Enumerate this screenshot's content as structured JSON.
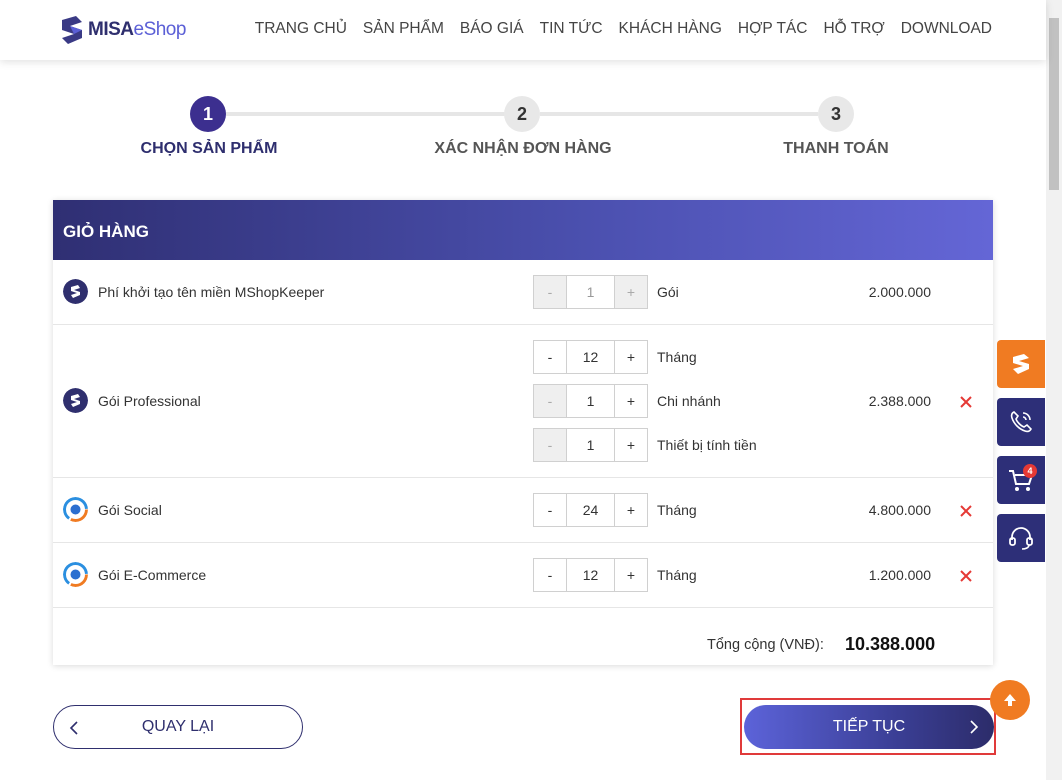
{
  "brand": {
    "logo_bold": "MISA",
    "logo_light": "eShop"
  },
  "nav": [
    "TRANG CHỦ",
    "SẢN PHẨM",
    "BÁO GIÁ",
    "TIN TỨC",
    "KHÁCH HÀNG",
    "HỢP TÁC",
    "HỖ TRỢ",
    "DOWNLOAD"
  ],
  "steps": [
    {
      "number": "1",
      "label": "CHỌN SẢN PHẨM",
      "active": true
    },
    {
      "number": "2",
      "label": "XÁC NHẬN ĐƠN HÀNG",
      "active": false
    },
    {
      "number": "3",
      "label": "THANH TOÁN",
      "active": false
    }
  ],
  "cart": {
    "title": "GIỎ HÀNG",
    "items": [
      {
        "name": "Phí khởi tạo tên miền MShopKeeper",
        "icon": "mshopkeeper-icon",
        "price": "2.000.000",
        "quantities": [
          {
            "minus": "-",
            "value": "1",
            "plus": "+",
            "unit": "Gói"
          }
        ]
      },
      {
        "name": "Gói Professional",
        "icon": "mshopkeeper-icon",
        "price": "2.388.000",
        "quantities": [
          {
            "minus": "-",
            "value": "12",
            "plus": "+",
            "unit": "Tháng"
          },
          {
            "minus": "-",
            "value": "1",
            "plus": "+",
            "unit": "Chi nhánh"
          },
          {
            "minus": "-",
            "value": "1",
            "plus": "+",
            "unit": "Thiết bị tính tiền"
          }
        ]
      },
      {
        "name": "Gói Social",
        "icon": "social-icon",
        "price": "4.800.000",
        "quantities": [
          {
            "minus": "-",
            "value": "24",
            "plus": "+",
            "unit": "Tháng"
          }
        ]
      },
      {
        "name": "Gói E-Commerce",
        "icon": "ecommerce-icon",
        "price": "1.200.000",
        "quantities": [
          {
            "minus": "-",
            "value": "12",
            "plus": "+",
            "unit": "Tháng"
          }
        ]
      }
    ],
    "total_label": "Tổng cộng (VNĐ):",
    "total_value": "10.388.000"
  },
  "buttons": {
    "back": "QUAY LẠI",
    "next": "TIẾP TỤC"
  },
  "side": {
    "cart_badge": "4"
  },
  "colors": {
    "primary": "#2f2f6e",
    "accent": "#5c63d9",
    "orange": "#f07b22",
    "remove": "#e53935"
  }
}
